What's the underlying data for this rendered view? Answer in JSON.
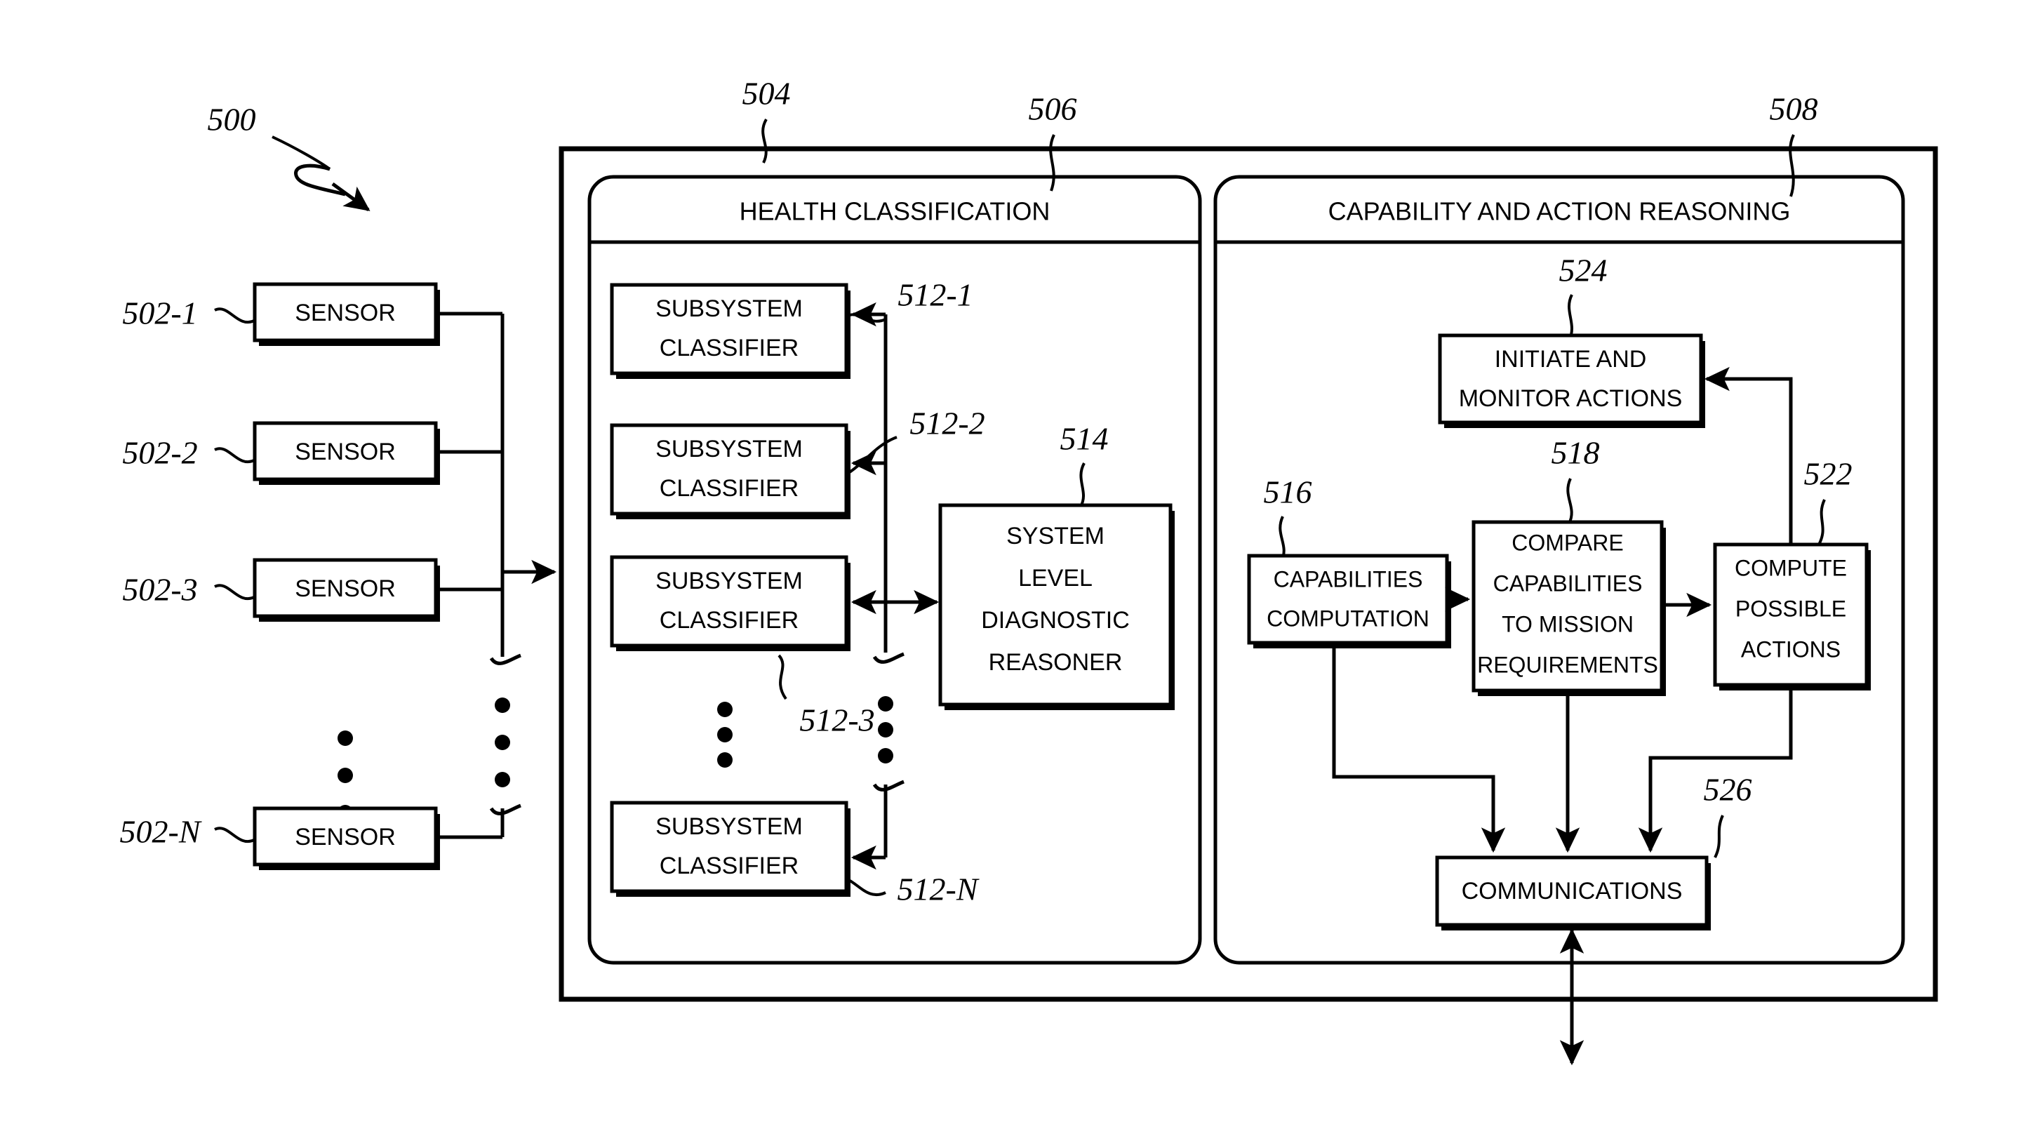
{
  "figure": {
    "main_ref": "500",
    "outer_container_ref": "504"
  },
  "sensors": {
    "label": "SENSOR",
    "items": [
      {
        "ref": "502-1",
        "label": "SENSOR"
      },
      {
        "ref": "502-2",
        "label": "SENSOR"
      },
      {
        "ref": "502-3",
        "label": "SENSOR"
      },
      {
        "ref": "502-N",
        "label": "SENSOR"
      }
    ]
  },
  "health_classification": {
    "ref": "506",
    "title": "HEALTH CLASSIFICATION",
    "classifiers": [
      {
        "ref": "512-1",
        "line1": "SUBSYSTEM",
        "line2": "CLASSIFIER"
      },
      {
        "ref": "512-2",
        "line1": "SUBSYSTEM",
        "line2": "CLASSIFIER"
      },
      {
        "ref": "512-3",
        "line1": "SUBSYSTEM",
        "line2": "CLASSIFIER"
      },
      {
        "ref": "512-N",
        "line1": "SUBSYSTEM",
        "line2": "CLASSIFIER"
      }
    ],
    "reasoner": {
      "ref": "514",
      "line1": "SYSTEM",
      "line2": "LEVEL",
      "line3": "DIAGNOSTIC",
      "line4": "REASONER"
    }
  },
  "capability_action_reasoning": {
    "ref": "508",
    "title": "CAPABILITY AND ACTION REASONING",
    "initiate_monitor": {
      "ref": "524",
      "line1": "INITIATE AND",
      "line2": "MONITOR ACTIONS"
    },
    "capabilities_computation": {
      "ref": "516",
      "line1": "CAPABILITIES",
      "line2": "COMPUTATION"
    },
    "compare_capabilities": {
      "ref": "518",
      "line1": "COMPARE",
      "line2": "CAPABILITIES",
      "line3": "TO MISSION",
      "line4": "REQUIREMENTS"
    },
    "compute_possible_actions": {
      "ref": "522",
      "line1": "COMPUTE",
      "line2": "POSSIBLE",
      "line3": "ACTIONS"
    },
    "communications": {
      "ref": "526",
      "label": "COMMUNICATIONS"
    }
  },
  "colors": {
    "ink": "#000000",
    "paper": "#ffffff"
  }
}
